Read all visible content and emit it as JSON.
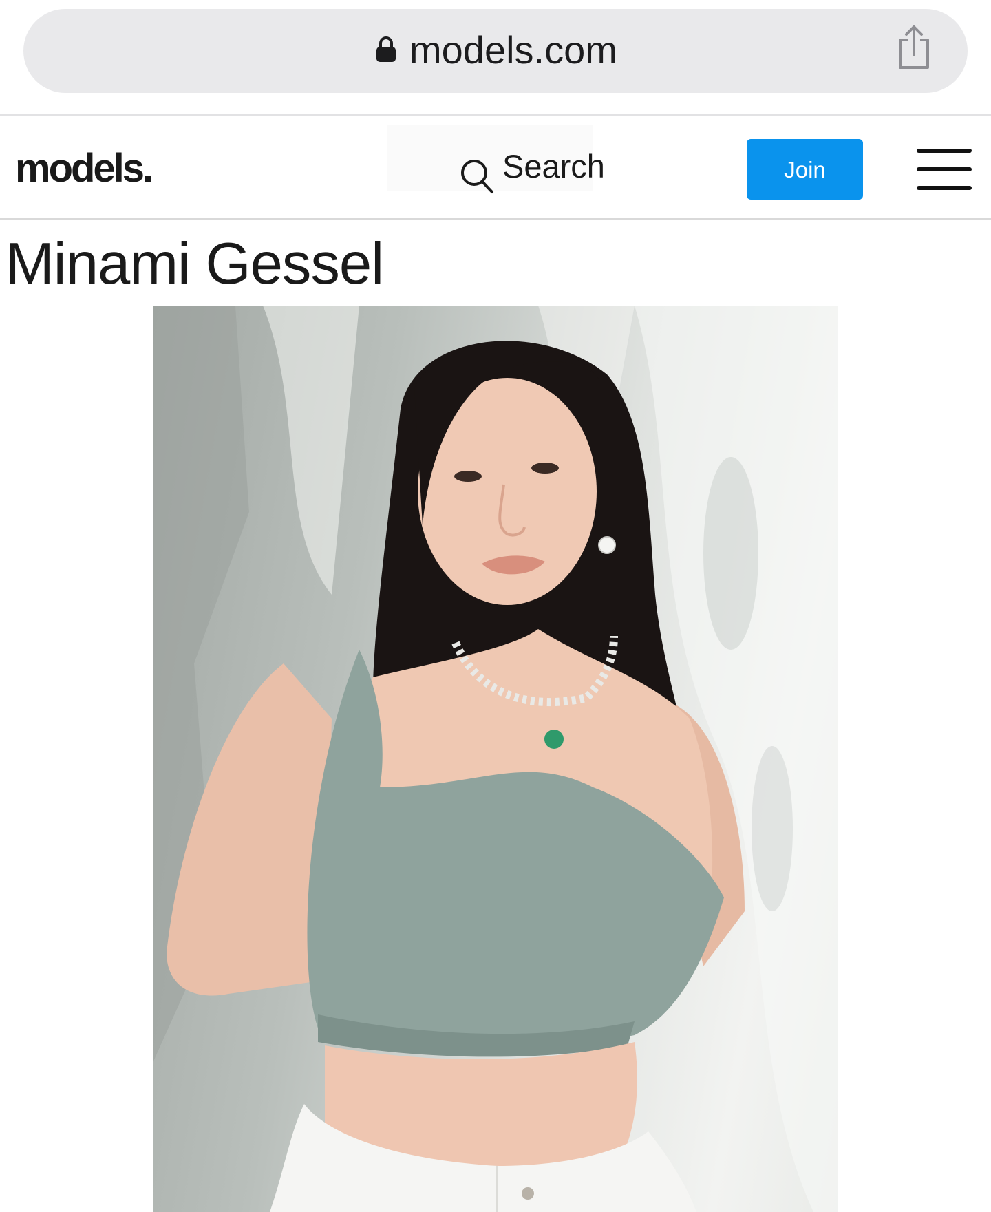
{
  "browser": {
    "url": "models.com",
    "icons": [
      "lock-icon",
      "share-icon"
    ]
  },
  "header": {
    "logo": "models.",
    "search_label": "Search",
    "join_label": "Join",
    "icons": [
      "search-icon",
      "menu-icon"
    ]
  },
  "profile": {
    "name": "Minami Gessel"
  },
  "colors": {
    "accent": "#0a93ed",
    "url_bar": "#e9e9eb",
    "text": "#1a1a1a"
  }
}
